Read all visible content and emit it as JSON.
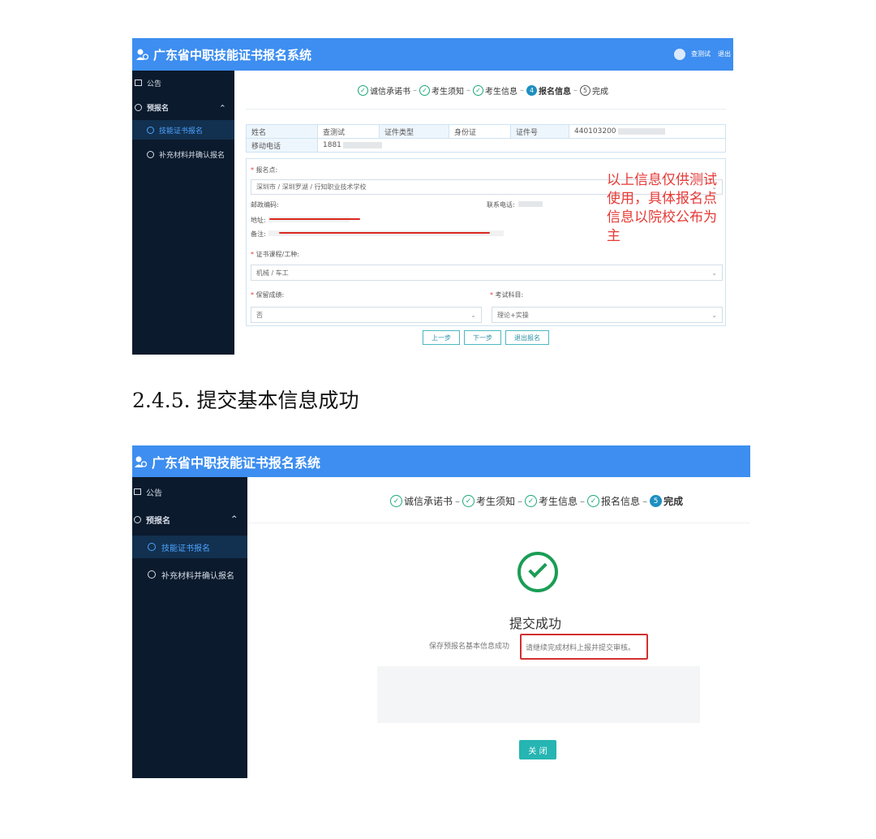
{
  "app": {
    "title": "广东省中职技能证书报名系统",
    "user_name": "查测试",
    "logout": "退出"
  },
  "sidebar": {
    "notice": "公告",
    "pre_register": "预报名",
    "pre_register_toggle": "^",
    "items": [
      "技能证书报名",
      "补充材料并确认报名"
    ]
  },
  "steps": [
    {
      "num": "✓",
      "label": "诚信承诺书"
    },
    {
      "num": "✓",
      "label": "考生须知"
    },
    {
      "num": "✓",
      "label": "考生信息"
    },
    {
      "num": "4",
      "label": "报名信息"
    },
    {
      "num": "5",
      "label": "完成"
    }
  ],
  "steps_done": [
    {
      "num": "✓",
      "label": "诚信承诺书"
    },
    {
      "num": "✓",
      "label": "考生须知"
    },
    {
      "num": "✓",
      "label": "考生信息"
    },
    {
      "num": "✓",
      "label": "报名信息"
    },
    {
      "num": "5",
      "label": "完成"
    }
  ],
  "step_separator": "–",
  "info_table": {
    "name_label": "姓名",
    "name_value": "查测试",
    "id_type_label": "证件类型",
    "id_type_value": "身份证",
    "id_no_label": "证件号",
    "id_no_value": "440103200",
    "mobile_label": "移动电话",
    "mobile_value": "1881"
  },
  "form": {
    "site_label": "报名点:",
    "site_value": "深圳市 / 深圳罗湖 / 行知职业技术学校",
    "zip_label": "邮政编码:",
    "phone_label": "联系电话:",
    "address_label": "地址:",
    "remark_label": "备注:",
    "course_label": "证书课程/工种:",
    "course_value": "机械 / 车工",
    "keep_score_label": "保留成绩:",
    "keep_score_value": "否",
    "subject_label": "考试科目:",
    "subject_value": "理论+实操",
    "required_mark": "*",
    "chevron": "⌄"
  },
  "buttons": {
    "prev": "上一步",
    "next": "下一步",
    "quit": "退出报名",
    "close": "关 闭"
  },
  "annotation": "以上信息仅供测试使用，具体报名点信息以院校公布为主",
  "section_heading": "2.4.5.   提交基本信息成功",
  "success": {
    "title": "提交成功",
    "message": "保存预报名基本信息成功",
    "highlight": "请继续完成材料上报并提交审核。"
  },
  "colors": {
    "topbar": "#3d8ef0",
    "sidebar": "#0b1a2c",
    "success_green": "#1a9d55",
    "annotation_red": "#e53935",
    "button_teal": "#26b5b2"
  }
}
